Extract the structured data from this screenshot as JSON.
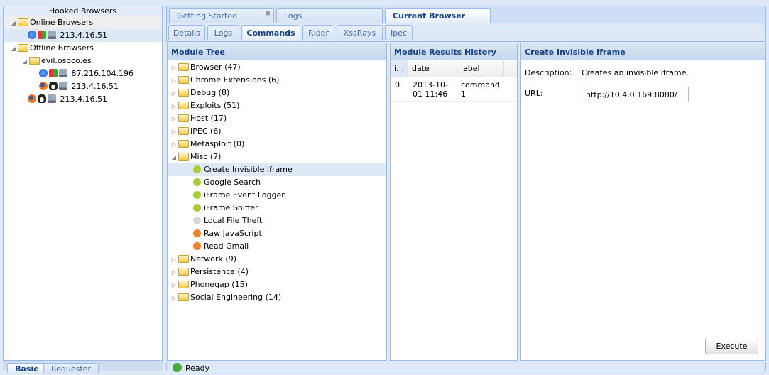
{
  "hooked": {
    "title": "Hooked Browsers",
    "online_label": "Online Browsers",
    "offline_label": "Offline Browsers",
    "online": [
      {
        "ip": "213.4.16.51",
        "browser": "ie",
        "os": "windows"
      }
    ],
    "domain": "evil.osoco.es",
    "domain_items": [
      {
        "ip": "87.216.104.196",
        "browser": "ie",
        "os": "windows"
      },
      {
        "ip": "213.4.16.51",
        "browser": "firefox",
        "os": "linux"
      }
    ],
    "offline_other": [
      {
        "ip": "213.4.16.51",
        "browser": "firefox",
        "os": "linux"
      }
    ],
    "bottom_tabs": [
      "Basic",
      "Requester"
    ]
  },
  "main_tabs": [
    "Getting Started",
    "Logs",
    "Current Browser"
  ],
  "sub_tabs": [
    "Details",
    "Logs",
    "Commands",
    "Rider",
    "XssRays",
    "Ipec"
  ],
  "module_tree": {
    "title": "Module Tree",
    "before": [
      "Browser (47)",
      "Chrome Extensions (6)",
      "Debug (8)",
      "Exploits (51)",
      "Host (17)",
      "IPEC (6)",
      "Metasploit (0)"
    ],
    "misc": "Misc (7)",
    "misc_items": [
      {
        "label": "Create Invisible Iframe",
        "color": "#a6cc3a"
      },
      {
        "label": "Google Search",
        "color": "#a6cc3a"
      },
      {
        "label": "iFrame Event Logger",
        "color": "#a6cc3a"
      },
      {
        "label": "iFrame Sniffer",
        "color": "#a6cc3a"
      },
      {
        "label": "Local File Theft",
        "color": "#d8d8d8"
      },
      {
        "label": "Raw JavaScript",
        "color": "#f0822e"
      },
      {
        "label": "Read Gmail",
        "color": "#f0822e"
      }
    ],
    "after": [
      "Network (9)",
      "Persistence (4)",
      "Phonegap (15)",
      "Social Engineering (14)"
    ]
  },
  "results": {
    "title": "Module Results History",
    "cols": [
      "i…",
      "date",
      "label"
    ],
    "rows": [
      {
        "id": "0",
        "date": "2013-10-01 11:46",
        "label": "command 1"
      }
    ]
  },
  "detail": {
    "title": "Create Invisible Iframe",
    "desc_label": "Description:",
    "desc": "Creates an invisible iframe.",
    "url_label": "URL:",
    "url": "http://10.4.0.169:8080/",
    "execute": "Execute"
  },
  "status": "Ready"
}
